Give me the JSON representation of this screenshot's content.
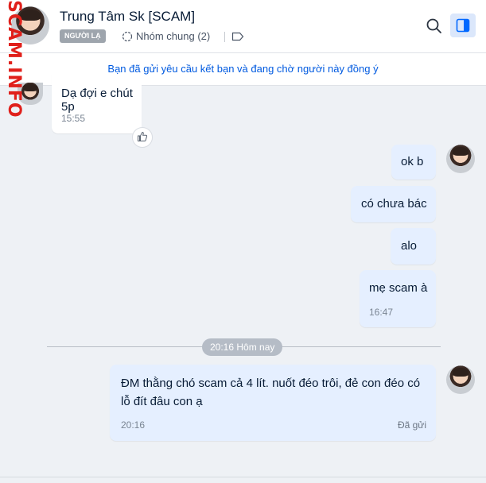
{
  "watermark": "SCAM.INFO",
  "header": {
    "title": "Trung Tâm Sk [SCAM]",
    "badge": "NGƯỜI LẠ",
    "groups": "Nhóm chung (2)"
  },
  "notice": "Bạn đã gửi yêu cầu kết bạn và đang chờ người này đồng ý",
  "messages": [
    {
      "side": "in",
      "text": "Dạ đợi e chút 5p",
      "time": "15:55"
    },
    {
      "side": "out",
      "text": "ok b"
    },
    {
      "side": "out",
      "text": "có chưa bác"
    },
    {
      "side": "out",
      "text": "alo"
    },
    {
      "side": "out",
      "text": "mẹ scam à",
      "time": "16:47"
    },
    {
      "side": "out",
      "text": "ĐM thằng chó scam cả 4 lít. nuốt đéo trôi, đẻ con đéo có lỗ đít đâu con ạ",
      "time": "20:16",
      "status": "Đã gửi"
    }
  ],
  "divider": "20:16 Hôm nay",
  "colors": {
    "notice_link": "#005ae0",
    "out_bubble": "#e5efff",
    "panel_active": "#dbe7fb",
    "watermark": "#e0201b"
  }
}
